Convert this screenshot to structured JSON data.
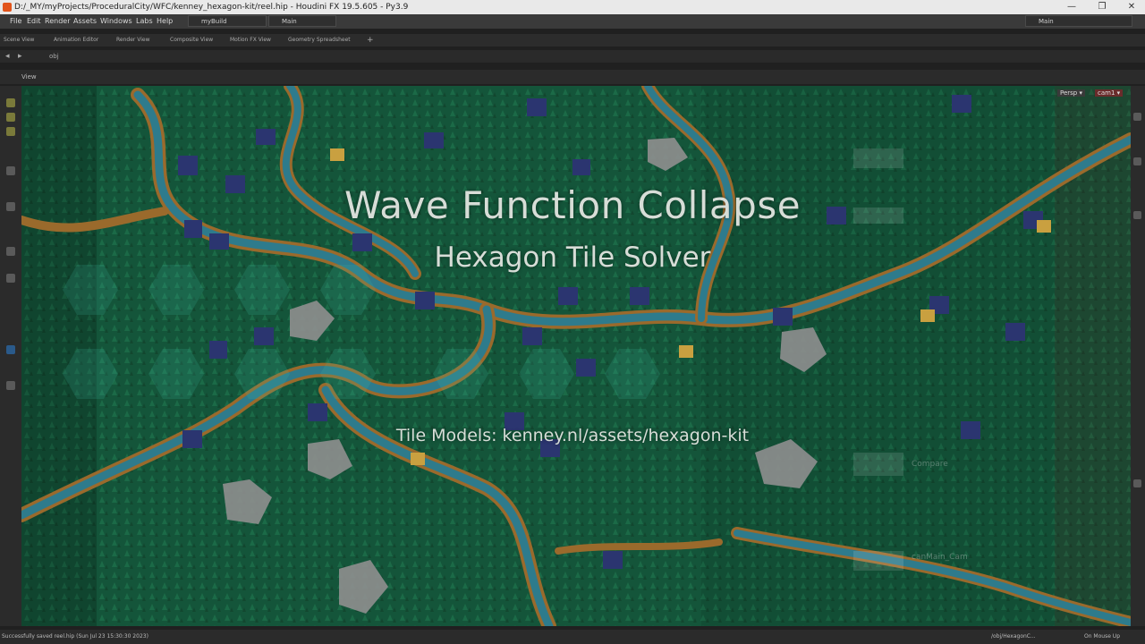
{
  "window": {
    "title": "D:/_MY/myProjects/ProceduralCity/WFC/kenney_hexagon-kit/reel.hip - Houdini FX 19.5.605 - Py3.9",
    "min": "—",
    "max": "❐",
    "close": "✕"
  },
  "menu": {
    "items": [
      "File",
      "Edit",
      "Render",
      "Assets",
      "Windows",
      "Labs",
      "Help"
    ],
    "build": "myBuild",
    "desktop": "Main",
    "right_desktop": "Main"
  },
  "tabs": [
    "Scene View",
    "Animation Editor",
    "Render View",
    "Composite View",
    "Motion FX View",
    "Geometry Spreadsheet"
  ],
  "path": {
    "context": "obj"
  },
  "view": {
    "label": "View",
    "persp": "Persp ▾",
    "cam": "cam1 ▾"
  },
  "overlay": {
    "title": "Wave Function Collapse",
    "subtitle": "Hexagon Tile Solver",
    "credit": "Tile Models: kenney.nl/assets/hexagon-kit"
  },
  "ghost_nodes": [
    "Compare",
    "canMain_Cam"
  ],
  "status": {
    "message": "Successfully saved reel.hip (Sun Jul 23 15:30:30 2023)",
    "path": "/obj/HexagonC...",
    "mode": "On Mouse Up"
  },
  "colors": {
    "grass": "#155a39",
    "river": "#2e7b8c",
    "road": "#9a6a2c",
    "house_roof": "#2b3570",
    "rock": "#8f8f8f",
    "accent": "#e2541b"
  }
}
